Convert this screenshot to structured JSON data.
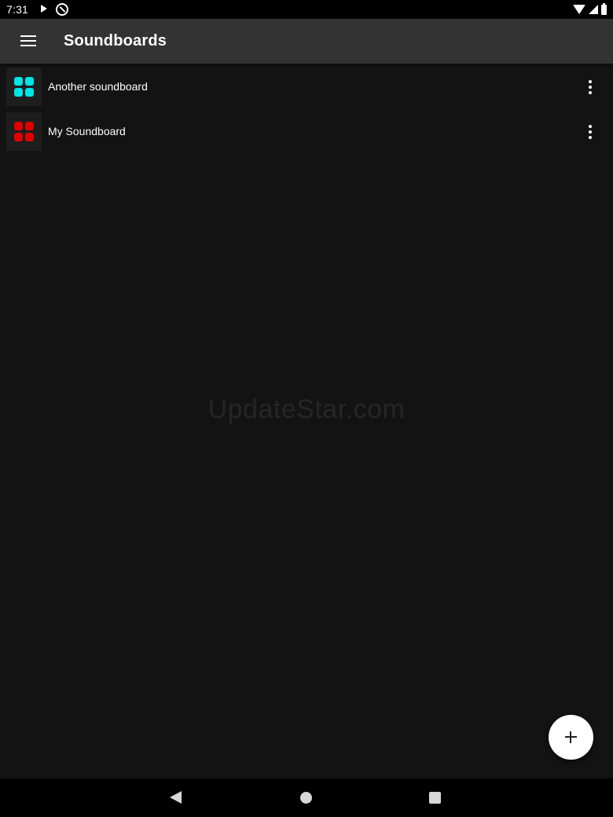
{
  "status_bar": {
    "time": "7:31",
    "icons": [
      "play-icon",
      "app-notification-icon",
      "wifi-icon",
      "signal-icon",
      "battery-icon"
    ]
  },
  "app_bar": {
    "title": "Soundboards",
    "menu_icon": "hamburger-menu-icon"
  },
  "soundboards": [
    {
      "name": "Another soundboard",
      "color": "#00e5e5",
      "more_icon": "more-vert-icon"
    },
    {
      "name": "My Soundboard",
      "color": "#e00000",
      "more_icon": "more-vert-icon"
    }
  ],
  "watermark": "UpdateStar.com",
  "fab": {
    "icon": "plus-icon"
  },
  "nav_bar": {
    "icons": [
      "back-icon",
      "home-icon",
      "recents-icon"
    ]
  },
  "colors": {
    "background": "#131313",
    "app_bar": "#333333",
    "text": "#ffffff",
    "fab": "#ffffff"
  }
}
